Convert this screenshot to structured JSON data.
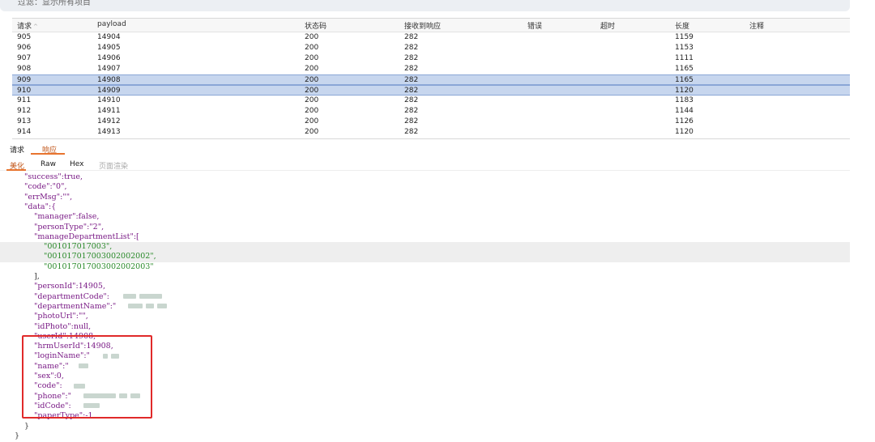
{
  "filter": {
    "text": "过滤：显示所有项目"
  },
  "table": {
    "headers": [
      "请求",
      "payload",
      "状态码",
      "接收到响应",
      "错误",
      "超时",
      "长度",
      "注释"
    ],
    "sort_glyph": "^",
    "rows": [
      [
        "905",
        "14904",
        "200",
        "282",
        "",
        "",
        "1159",
        ""
      ],
      [
        "906",
        "14905",
        "200",
        "282",
        "",
        "",
        "1153",
        ""
      ],
      [
        "907",
        "14906",
        "200",
        "282",
        "",
        "",
        "1111",
        ""
      ],
      [
        "908",
        "14907",
        "200",
        "282",
        "",
        "",
        "1165",
        ""
      ],
      [
        "909",
        "14908",
        "200",
        "282",
        "",
        "",
        "1165",
        ""
      ],
      [
        "910",
        "14909",
        "200",
        "282",
        "",
        "",
        "1120",
        ""
      ],
      [
        "911",
        "14910",
        "200",
        "282",
        "",
        "",
        "1183",
        ""
      ],
      [
        "912",
        "14911",
        "200",
        "282",
        "",
        "",
        "1144",
        ""
      ],
      [
        "913",
        "14912",
        "200",
        "282",
        "",
        "",
        "1126",
        ""
      ],
      [
        "914",
        "14913",
        "200",
        "282",
        "",
        "",
        "1120",
        ""
      ]
    ],
    "selected_rows": [
      "909",
      "910"
    ]
  },
  "tabs": {
    "request": "请求",
    "response": "响应"
  },
  "view_tabs": {
    "pretty": "美化",
    "raw": "Raw",
    "hex": "Hex",
    "render": "页面渲染"
  },
  "json_lines": [
    "\"success\":true,",
    "\"code\":\"0\",",
    "\"errMsg\":\"\",",
    "\"data\":{",
    "\"manager\":false,",
    "\"personType\":\"2\",",
    "\"manageDepartmentList\":[",
    "\"001017017003\",",
    "\"001017017003002002002\",",
    "\"001017017003002002003\"",
    "],",
    "\"personId\":14905,",
    "\"departmentCode\":",
    "\"departmentName\":\"",
    "\"photoUrl\":\"\",",
    "\"idPhoto\":null,",
    "\"userId\":14908,",
    "\"hrmUserId\":14908,",
    "\"loginName\":\"",
    "\"name\":\"",
    "\"sex\":0,",
    "\"code\":",
    "\"phone\":\"",
    "\"idCode\":",
    "\"paperType\":-1",
    "}",
    "}"
  ],
  "colors": {
    "accent": "#e8742e",
    "selection": "#c7d6ee",
    "highlight_box": "#e02a2a",
    "json_key": "#7a1b86",
    "json_string": "#2a8a2a",
    "json_number": "#2a49b8"
  }
}
